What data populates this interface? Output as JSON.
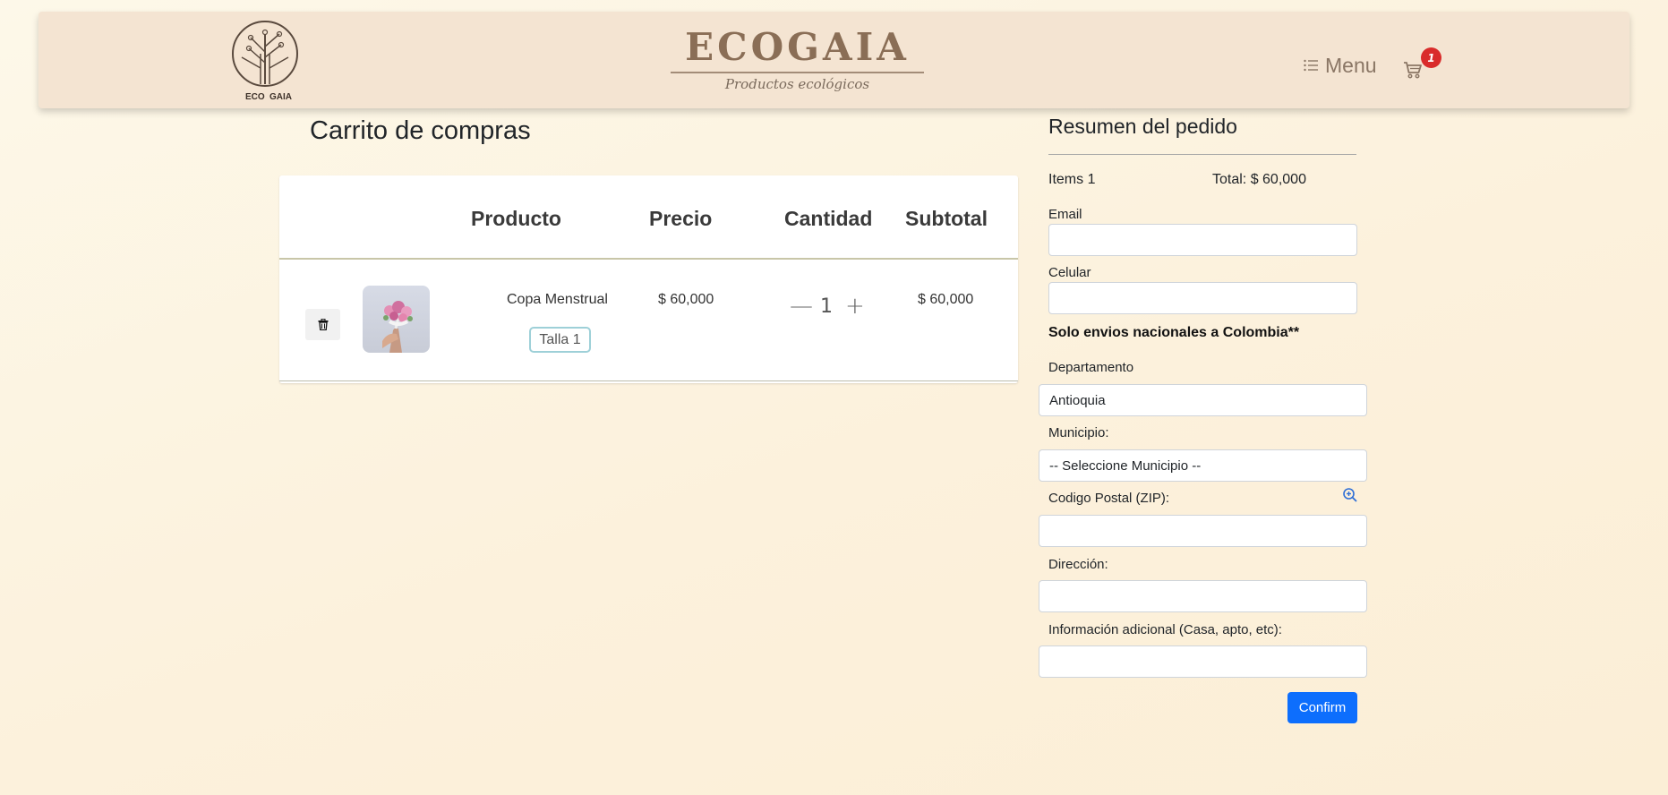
{
  "header": {
    "brand_title": "ECOGAIA",
    "brand_subtitle": "Productos ecológicos",
    "logo_text_left": "ECO",
    "logo_text_right": "GAIA",
    "menu_label": "Menu",
    "cart_count": "1"
  },
  "cart": {
    "title": "Carrito de compras",
    "columns": [
      "",
      "Producto",
      "Precio",
      "Cantidad",
      "Subtotal"
    ],
    "items": [
      {
        "name": "Copa Menstrual",
        "size": "Talla 1",
        "price": "$ 60,000",
        "quantity": "1",
        "subtotal": "$ 60,000"
      }
    ],
    "decrement_glyph": "—",
    "increment_glyph": "+"
  },
  "summary": {
    "title": "Resumen del pedido",
    "items_label": "Items 1",
    "total_label": "Total: $ 60,000",
    "email_label": "Email",
    "email_value": "",
    "phone_label": "Celular",
    "phone_value": "",
    "shipping_note": "Solo envios nacionales a Colombia**",
    "department_label": "Departamento",
    "department_value": "Antioquia",
    "municipality_label": "Municipio:",
    "municipality_value": "-- Seleccione Municipio --",
    "zip_label": "Codigo Postal (ZIP):",
    "zip_value": "",
    "address_label": "Dirección:",
    "address_value": "",
    "extra_label": "Información adicional (Casa, apto, etc):",
    "extra_value": "",
    "confirm_label": "Confirm"
  },
  "colors": {
    "brand": "#8a6e56",
    "header_bg": "#f4e4d2",
    "badge": "#d92b2b",
    "primary": "#0d6efd",
    "size_tag_border": "#9ed0d8"
  },
  "icons": {
    "trash": "trash-icon",
    "cart": "cart-icon",
    "menu": "list-icon",
    "zoom": "zoom-in-icon"
  }
}
